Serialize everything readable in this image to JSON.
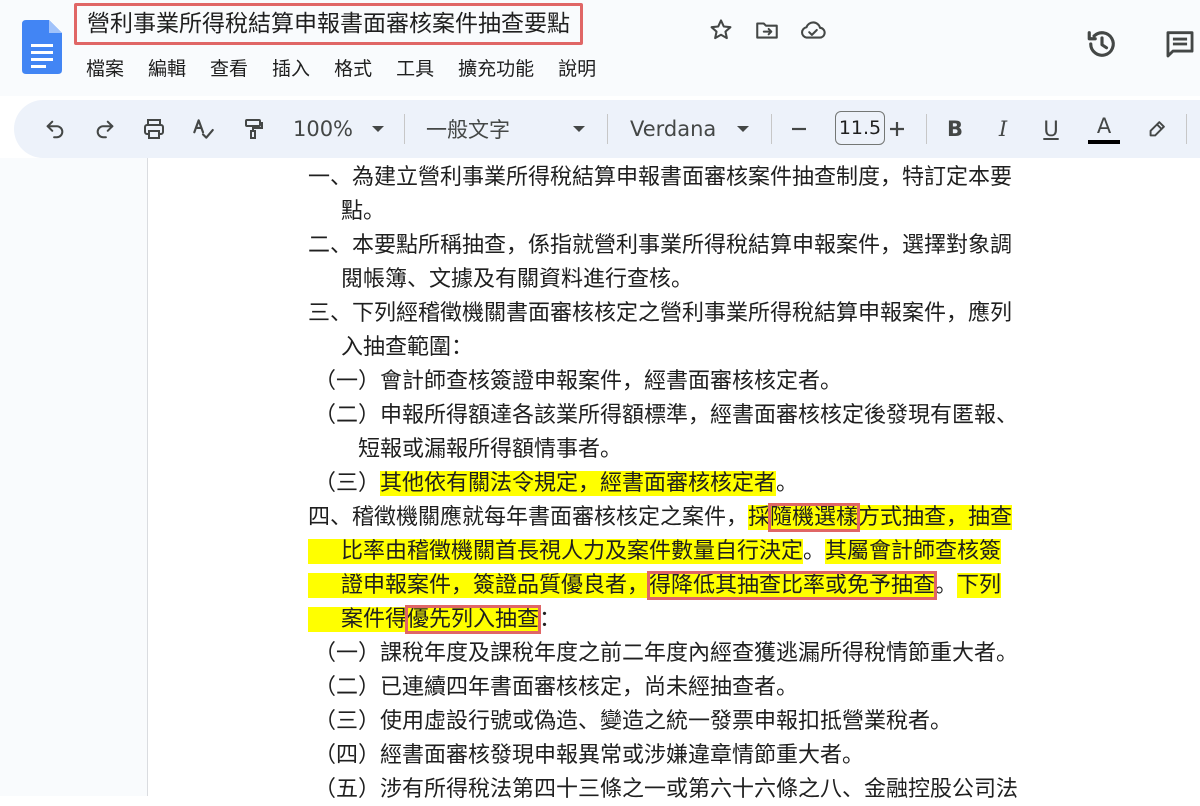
{
  "document": {
    "title": "營利事業所得稅結算申報書面審核案件抽查要點"
  },
  "menu": [
    "檔案",
    "編輯",
    "查看",
    "插入",
    "格式",
    "工具",
    "擴充功能",
    "說明"
  ],
  "toolbar": {
    "zoom": "100%",
    "paragraph_style": "一般文字",
    "font": "Verdana",
    "font_size": "11.5",
    "bold": "B",
    "italic": "I",
    "underline": "U",
    "text_color": "A"
  },
  "content": {
    "l1": "一、為建立營利事業所得稅結算申報書面審核案件抽查制度，特訂定本要",
    "l2": "點。",
    "l3": "二、本要點所稱抽查，係指就營利事業所得稅結算申報案件，選擇對象調",
    "l4": "閱帳簿、文據及有關資料進行查核。",
    "l5": "三、下列經稽徵機關書面審核核定之營利事業所得稅結算申報案件，應列",
    "l6": "入抽查範圍：",
    "l7": "（一）會計師查核簽證申報案件，經書面審核核定者。",
    "l8": "（二）申報所得額達各該業所得額標準，經書面審核核定後發現有匿報、",
    "l9": "短報或漏報所得額情事者。",
    "l10a": "（三）",
    "l10b": "其他依有關法令規定，經書面審核核定者",
    "l10c": "。",
    "l11a": "四、稽徵機關應就每年書面審核核定之案件，",
    "l11b": "採",
    "l11c": "隨機選樣",
    "l11d": "方式抽查，抽查",
    "l12a": "比率由稽徵機關首長視人力及案件數量自行決定",
    "l12b": "。",
    "l12c": "其屬會計師查核簽",
    "l13a": "證申報案件，簽證品質優良者，",
    "l13b": "得降低其抽查比率或免予抽查",
    "l13c": "。",
    "l13d": "下列",
    "l14a": "案件得",
    "l14b": "優先列入抽查",
    "l14c": "：",
    "l15": "（一）課稅年度及課稅年度之前二年度內經查獲逃漏所得稅情節重大者。",
    "l16": "（二）已連續四年書面審核核定，尚未經抽查者。",
    "l17": "（三）使用虛設行號或偽造、變造之統一發票申報扣抵營業稅者。",
    "l18": "（四）經書面審核發現申報異常或涉嫌違章情節重大者。",
    "l19": "（五）涉有所得稅法第四十三條之一或第六十六條之八、金融控股公司法"
  },
  "icons": {
    "logo": "google-docs-logo",
    "star": "star-icon",
    "move": "move-to-folder-icon",
    "cloud": "cloud-saved-icon",
    "history": "version-history-icon",
    "comments": "comments-icon"
  },
  "colors": {
    "highlight": "#ffff00",
    "annotation_box": "#e06666",
    "docs_blue": "#4285f4"
  }
}
